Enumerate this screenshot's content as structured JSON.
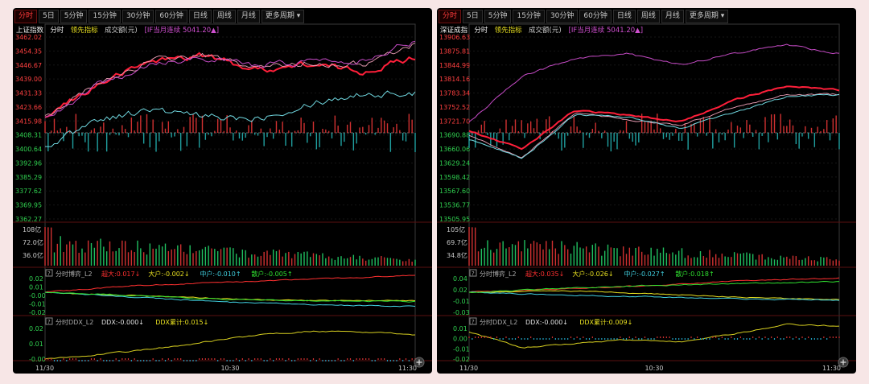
{
  "panels": [
    {
      "id": "sh",
      "tabs": [
        "分时",
        "5日",
        "5分钟",
        "15分钟",
        "30分钟",
        "60分钟",
        "日线",
        "周线",
        "月线",
        "更多周期"
      ],
      "legend": {
        "index_name": "上证指数",
        "mode": "分时",
        "leading": "领先指标",
        "volume_unit": "成交额(元)",
        "futures": "[IF当月连续 5041.20▲]"
      },
      "price_ticks": [
        "3462.02",
        "3454.35",
        "3446.67",
        "3439.00",
        "3431.33",
        "3423.66",
        "3415.98",
        "3408.31",
        "3400.64",
        "3392.96",
        "3385.29",
        "3377.62",
        "3369.95",
        "3362.27"
      ],
      "volume_ticks": [
        "108亿",
        "72.0亿",
        "36.0亿"
      ],
      "ind1": {
        "label": "分时博弈_L2",
        "items": [
          {
            "text": "超大:0.017↓",
            "color": "#ff3030"
          },
          {
            "text": "大户:-0.002↓",
            "color": "#e8e020"
          },
          {
            "text": "中户:-0.010↑",
            "color": "#40d0e0"
          },
          {
            "text": "散户:-0.005↑",
            "color": "#30e030"
          }
        ],
        "ticks": [
          "0.02",
          "0.01",
          "-0.00",
          "-0.01",
          "-0.02"
        ]
      },
      "ind2": {
        "label": "分时DDX_L2",
        "items": [
          {
            "text": "DDX:-0.000↓",
            "color": "#e0e0e0"
          },
          {
            "text": "DDX累计:0.015↓",
            "color": "#e8e020"
          }
        ],
        "ticks": [
          "0.02",
          "0.01",
          "-0.00"
        ]
      },
      "time_labels": [
        "11/30",
        "10:30",
        "11:30"
      ]
    },
    {
      "id": "sz",
      "tabs": [
        "分时",
        "5日",
        "5分钟",
        "15分钟",
        "30分钟",
        "60分钟",
        "日线",
        "周线",
        "月线",
        "更多周期"
      ],
      "legend": {
        "index_name": "深证成指",
        "mode": "分时",
        "leading": "领先指标",
        "volume_unit": "成交额(元)",
        "futures": "[IF当月连续 5041.20▲]"
      },
      "price_ticks": [
        "13906.63",
        "13875.81",
        "13844.99",
        "13814.16",
        "13783.34",
        "13752.52",
        "13721.70",
        "13690.88",
        "13660.06",
        "13629.24",
        "13598.42",
        "13567.60",
        "13536.77",
        "13505.95"
      ],
      "volume_ticks": [
        "105亿",
        "69.7亿",
        "34.8亿"
      ],
      "ind1": {
        "label": "分时博弈_L2",
        "items": [
          {
            "text": "超大:0.035↓",
            "color": "#ff3030"
          },
          {
            "text": "大户:-0.026↓",
            "color": "#e8e020"
          },
          {
            "text": "中户:-0.027↑",
            "color": "#40d0e0"
          },
          {
            "text": "散户:0.018↑",
            "color": "#30e030"
          }
        ],
        "ticks": [
          "0.04",
          "0.02",
          "-0.01",
          "-0.03"
        ]
      },
      "ind2": {
        "label": "分时DDX_L2",
        "items": [
          {
            "text": "DDX:-0.000↓",
            "color": "#e0e0e0"
          },
          {
            "text": "DDX累计:0.009↓",
            "color": "#e8e020"
          }
        ],
        "ticks": [
          "0.01",
          "0.00",
          "-0.01",
          "-0.02"
        ]
      },
      "time_labels": [
        "11/30",
        "10:30",
        "11:30"
      ]
    }
  ],
  "chart_data": [
    {
      "type": "line",
      "title": "上证指数 分时",
      "x": [
        "09:30",
        "10:30",
        "11:30"
      ],
      "ylim": [
        3362.27,
        3462.02
      ],
      "series": [
        {
          "name": "上证指数",
          "values": [
            3418,
            3436,
            3449,
            3452,
            3444,
            3447,
            3443,
            3451
          ]
        },
        {
          "name": "领先指标",
          "values": [
            3419,
            3436,
            3449,
            3452,
            3445,
            3448,
            3447,
            3458
          ]
        },
        {
          "name": "IF当月连续",
          "values": [
            3402,
            3417,
            3422,
            3418,
            3418,
            3426,
            3431,
            3431
          ]
        }
      ],
      "volume_max": "108亿"
    },
    {
      "type": "line",
      "title": "深证成指 分时",
      "x": [
        "09:30",
        "10:30",
        "11:30"
      ],
      "ylim": [
        13505.95,
        13906.63
      ],
      "series": [
        {
          "name": "深证成指",
          "values": [
            13700,
            13660,
            13745,
            13735,
            13720,
            13768,
            13798,
            13790
          ]
        },
        {
          "name": "领先指标",
          "values": [
            13690,
            13640,
            13740,
            13725,
            13712,
            13752,
            13780,
            13780
          ]
        },
        {
          "name": "IF当月连续",
          "values": [
            13720,
            13820,
            13860,
            13870,
            13845,
            13870,
            13890,
            13870
          ]
        }
      ],
      "volume_max": "105亿"
    }
  ]
}
